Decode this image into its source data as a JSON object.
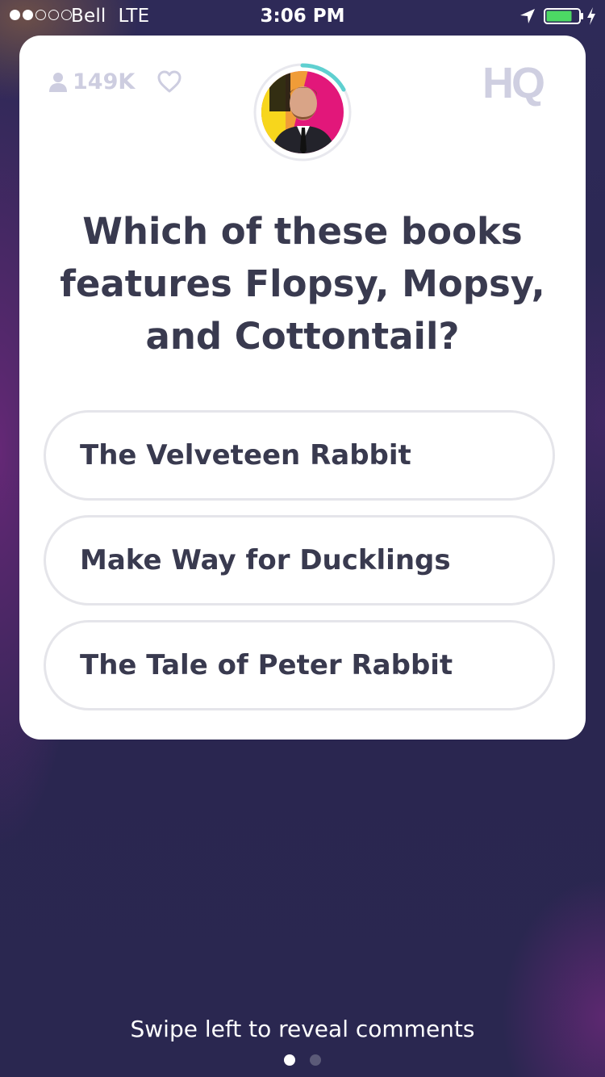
{
  "status_bar": {
    "carrier": "Bell",
    "network": "LTE",
    "time": "3:06 PM",
    "signal_bars_filled": 2,
    "signal_bars_total": 5,
    "battery_level": 0.8
  },
  "header": {
    "viewer_count": "149K",
    "logo": "HQ"
  },
  "question": {
    "text": "Which of these books features Flopsy, Mopsy, and Cottontail?"
  },
  "answers": [
    {
      "label": "The Velveteen Rabbit"
    },
    {
      "label": "Make Way for Ducklings"
    },
    {
      "label": "The Tale of Peter Rabbit"
    }
  ],
  "footer": {
    "hint": "Swipe left to reveal comments",
    "pages_total": 2,
    "active_page": 1
  },
  "colors": {
    "background": "#2b2752",
    "card": "#ffffff",
    "text_dark": "#393a4f",
    "muted": "#cdcde0",
    "timer_ring": "#5fd0d0",
    "battery": "#4cd964"
  },
  "icons": [
    "person-icon",
    "heart-icon",
    "location-arrow-icon",
    "battery-icon",
    "charging-bolt-icon"
  ]
}
